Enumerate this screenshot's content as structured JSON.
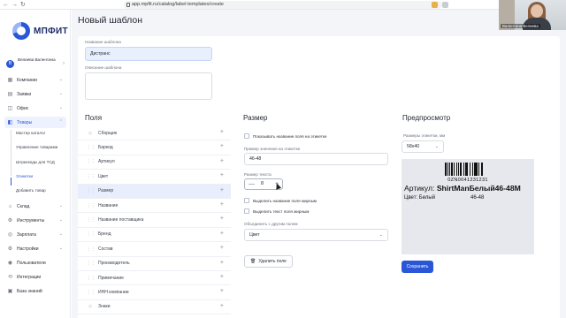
{
  "browser": {
    "url": "app.mpfit.ru/catalog/label-templates/create",
    "back_glyph": "←",
    "forward_glyph": "→",
    "reload_glyph": "↻"
  },
  "logo": {
    "text": "МПФИТ"
  },
  "user": {
    "initial": "В",
    "name": "Велиева Валентина",
    "chevron": "›"
  },
  "sidebar": {
    "items": [
      {
        "key": "companies",
        "label": "Компании",
        "icon": "▦",
        "arrow": "⌄"
      },
      {
        "key": "orders",
        "label": "Заявки",
        "icon": "▤",
        "arrow": "⌄"
      },
      {
        "key": "office",
        "label": "Офис",
        "icon": "◫",
        "arrow": "⌄"
      },
      {
        "key": "goods",
        "label": "Товары",
        "icon": "◧",
        "arrow": "⌃",
        "active": true
      },
      {
        "key": "warehouse",
        "label": "Склад",
        "icon": "⌂",
        "arrow": "⌄"
      },
      {
        "key": "tools",
        "label": "Инструменты",
        "icon": "⚙",
        "arrow": "⌄"
      },
      {
        "key": "salary",
        "label": "Зарплата",
        "icon": "◎",
        "arrow": "⌄"
      },
      {
        "key": "settings",
        "label": "Настройки",
        "icon": "⚙",
        "arrow": "⌄"
      },
      {
        "key": "users",
        "label": "Пользователи",
        "icon": "◉",
        "arrow": ""
      },
      {
        "key": "integrations",
        "label": "Интеграции",
        "icon": "⟲",
        "arrow": ""
      },
      {
        "key": "kb",
        "label": "База знаний",
        "icon": "▣",
        "arrow": ""
      }
    ],
    "subitems": [
      {
        "label": "Мастер каталог"
      },
      {
        "label": "Управление товарами"
      },
      {
        "label": "Штрихкоды для ТСД"
      },
      {
        "label": "Этикетки",
        "active": true
      },
      {
        "label": "Добавить товар"
      }
    ]
  },
  "page": {
    "title": "Новый шаблон"
  },
  "form": {
    "name_label": "Название шаблона",
    "name_value": "Дистранс",
    "desc_label": "Описание шаблона",
    "desc_value": ""
  },
  "fields": {
    "title": "Поля",
    "handle_glyph": "⋮⋮",
    "plus_glyph": "+",
    "items": [
      {
        "label": "Сборщик",
        "icon": "◇"
      },
      {
        "label": "Баркод"
      },
      {
        "label": "Артикул"
      },
      {
        "label": "Цвет"
      },
      {
        "label": "Размер",
        "selected": true
      },
      {
        "label": "Название"
      },
      {
        "label": "Название поставщика"
      },
      {
        "label": "Бренд"
      },
      {
        "label": "Состав"
      },
      {
        "label": "Производитель"
      },
      {
        "label": "Примечание"
      },
      {
        "label": "ИНН компании"
      },
      {
        "label": "Знаки",
        "icon": "◇"
      }
    ]
  },
  "size": {
    "title": "Размер",
    "show_name_label": "Показывать название поля на этикетке",
    "example_label": "Пример значения на этикетке",
    "example_value": "46-48",
    "text_size_label": "Размер текста",
    "text_size_value": "8",
    "minus_glyph": "—",
    "plus_glyph": "+",
    "bold_name_label": "Выделить название поля жирным",
    "bold_text_label": "Выделить текст поля жирным",
    "merge_label": "Объединить с другим полем",
    "merge_value": "Цвет",
    "merge_chevron": "⌄",
    "delete_icon": "🗑",
    "delete_label": "Удалить поле"
  },
  "preview": {
    "title": "Предпросмотр",
    "size_label": "Размеры этикетки, мм",
    "size_value": "58x40",
    "size_chevron": "⌄",
    "code": "0ZN0041231231",
    "article_prefix": "Артикул: ",
    "article_value": "ShirtМanБелый46-48M",
    "color_line": "Цвет: Белый",
    "size_line": "46-48",
    "save_label": "Сохранить"
  },
  "cam": {
    "caption": "Валентина Велиева"
  },
  "colors": {
    "accent": "#2a56d8",
    "page_bg": "#f4f5f8",
    "selected_row": "#e9eefc"
  }
}
